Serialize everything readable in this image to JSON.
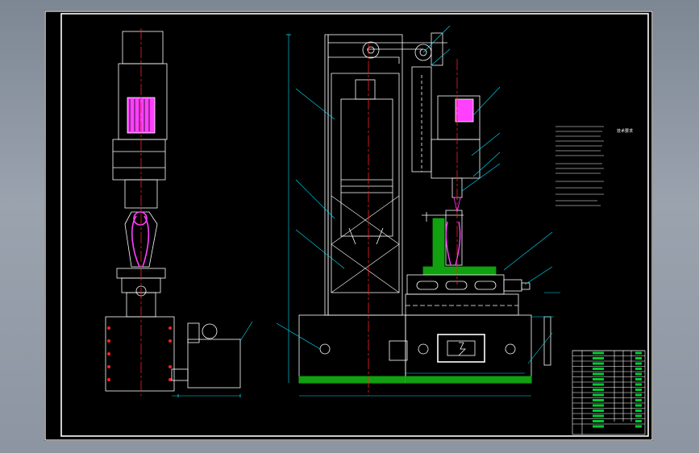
{
  "drawing": {
    "notes_title": "技术要求",
    "colors": {
      "background": "#000000",
      "frame": "#ffffff",
      "structure": "#ffffff",
      "centerline": "#ff2020",
      "highlight": "#ff40ff",
      "leader": "#00e0ff",
      "table_fill": "#00cc33",
      "base_green": "#10a010",
      "outer_bg": "#8c95a1"
    },
    "icons": [
      "motor-icon",
      "pulley-icon",
      "bolt-hole-icon",
      "control-panel-icon"
    ]
  }
}
